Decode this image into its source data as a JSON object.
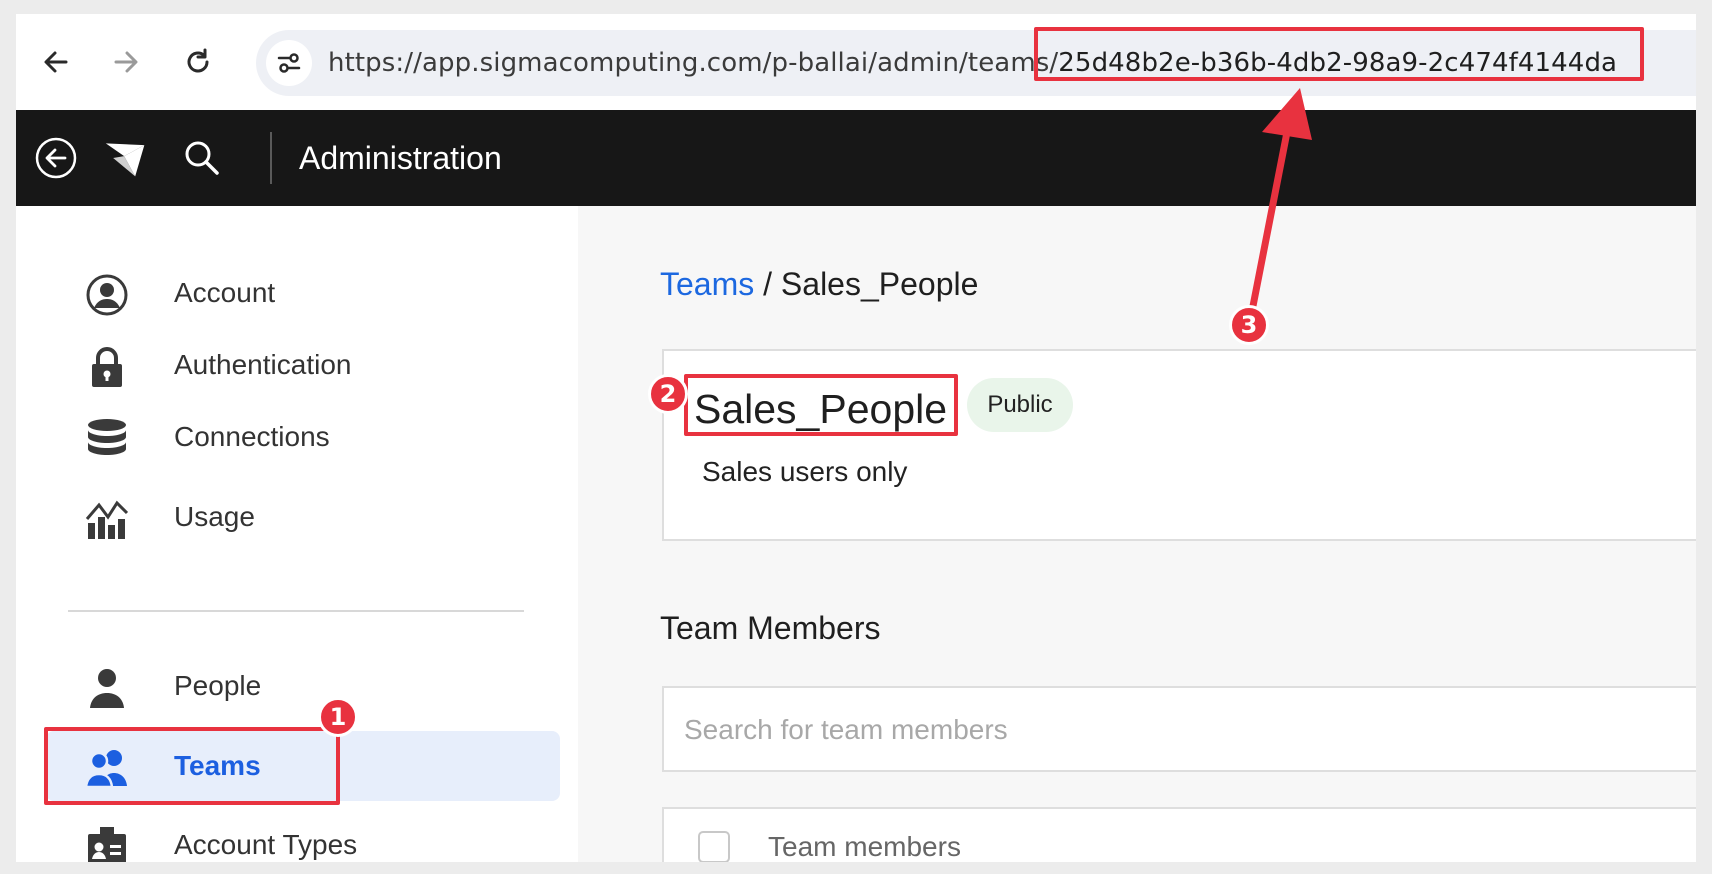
{
  "browser": {
    "url_prefix": "https://app.sigmacomputing.com/p-ballai/admin/teams/",
    "url_team_id": "25d48b2e-b36b-4db2-98a9-2c474f4144da",
    "icons": [
      "back-arrow-icon",
      "forward-arrow-icon",
      "reload-icon",
      "site-settings-icon"
    ]
  },
  "header": {
    "title": "Administration",
    "icons": [
      "back-circle-icon",
      "sigma-logo-icon",
      "search-icon"
    ]
  },
  "sidebar": {
    "items": [
      {
        "label": "Account",
        "icon": "user-circle-icon"
      },
      {
        "label": "Authentication",
        "icon": "lock-icon"
      },
      {
        "label": "Connections",
        "icon": "database-icon"
      },
      {
        "label": "Usage",
        "icon": "usage-chart-icon"
      },
      {
        "label": "People",
        "icon": "person-icon"
      },
      {
        "label": "Teams",
        "icon": "team-icon",
        "active": true
      },
      {
        "label": "Account Types",
        "icon": "badge-id-icon"
      }
    ]
  },
  "main": {
    "breadcrumb": {
      "link": "Teams",
      "separator": " / ",
      "current": "Sales_People"
    },
    "team": {
      "name": "Sales_People",
      "visibility": "Public",
      "description": "Sales users only"
    },
    "members_title": "Team Members",
    "search_placeholder": "Search for team members",
    "table_header": "Team members"
  },
  "annotations": {
    "markers": [
      "1",
      "2",
      "3"
    ],
    "color": "#e8323f"
  },
  "colors": {
    "accent": "#1c68e0",
    "header_bg": "#171717",
    "active_bg": "#e7eefb",
    "badge_bg": "#e9f5ea"
  }
}
